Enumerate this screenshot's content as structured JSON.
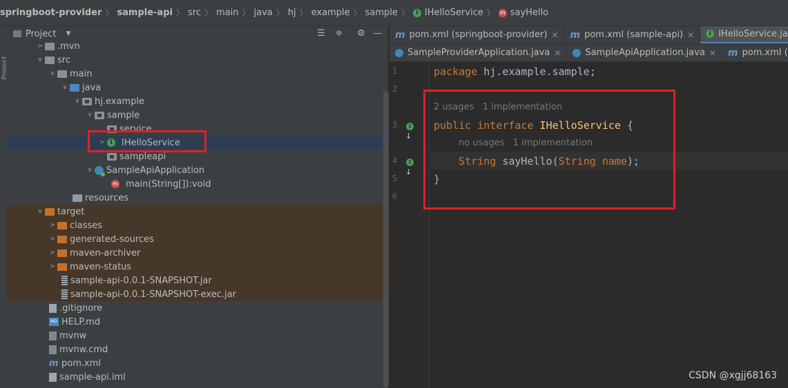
{
  "breadcrumb": {
    "items": [
      "springboot-provider",
      "sample-api",
      "src",
      "main",
      "java",
      "hj",
      "example",
      "sample",
      "IHelloService",
      "sayHello"
    ]
  },
  "project_panel": {
    "stripe_label": "Project",
    "title": "Project",
    "tree": [
      {
        "label": ".mvn"
      },
      {
        "label": "src"
      },
      {
        "label": "main"
      },
      {
        "label": "java"
      },
      {
        "label": "hj.example"
      },
      {
        "label": "sample"
      },
      {
        "label": "service"
      },
      {
        "label": "IHelloService"
      },
      {
        "label": "sampleapi"
      },
      {
        "label": "SampleApiApplication"
      },
      {
        "label": "main(String[]):void"
      },
      {
        "label": "resources"
      },
      {
        "label": "target"
      },
      {
        "label": "classes"
      },
      {
        "label": "generated-sources"
      },
      {
        "label": "maven-archiver"
      },
      {
        "label": "maven-status"
      },
      {
        "label": "sample-api-0.0.1-SNAPSHOT.jar"
      },
      {
        "label": "sample-api-0.0.1-SNAPSHOT-exec.jar"
      },
      {
        "label": ".gitignore"
      },
      {
        "label": "HELP.md"
      },
      {
        "label": "mvnw"
      },
      {
        "label": "mvnw.cmd"
      },
      {
        "label": "pom.xml"
      },
      {
        "label": "sample-api.iml"
      }
    ]
  },
  "editor": {
    "tabs_row1": [
      {
        "label": "pom.xml (springboot-provider)",
        "icon": "maven-icon"
      },
      {
        "label": "pom.xml (sample-api)",
        "icon": "maven-icon"
      },
      {
        "label": "IHelloService.java",
        "icon": "interface-icon",
        "active": true
      }
    ],
    "tabs_row2": [
      {
        "label": "SampleProviderApplication.java",
        "icon": "spring-class-icon"
      },
      {
        "label": "SampleApiApplication.java",
        "icon": "spring-class-icon"
      },
      {
        "label": "pom.xml (sample-p",
        "icon": "maven-icon"
      }
    ],
    "line_numbers": [
      "1",
      "2",
      "3",
      "4",
      "5",
      "6"
    ],
    "code": {
      "l1_kw": "package",
      "l1_rest": " hj.example.sample;",
      "hint1_usages": "2 usages",
      "hint1_impl": "1 implementation",
      "l3_kw1": "public",
      "l3_kw2": "interface",
      "l3_name": "IHelloService",
      "l3_rest": " {",
      "hint2_usages": "no usages",
      "hint2_impl": "1 implementation",
      "l4_type": "String",
      "l4_method": "sayHello",
      "l4_paren": "(",
      "l4_ptype": "String",
      "l4_pname": " name",
      "l4_end": ");",
      "l5": "}"
    }
  },
  "watermark": "CSDN @xgjj68163",
  "colors": {
    "highlight_box": "#e0202a",
    "keyword": "#cc7832",
    "identifier": "#ffc66d"
  }
}
